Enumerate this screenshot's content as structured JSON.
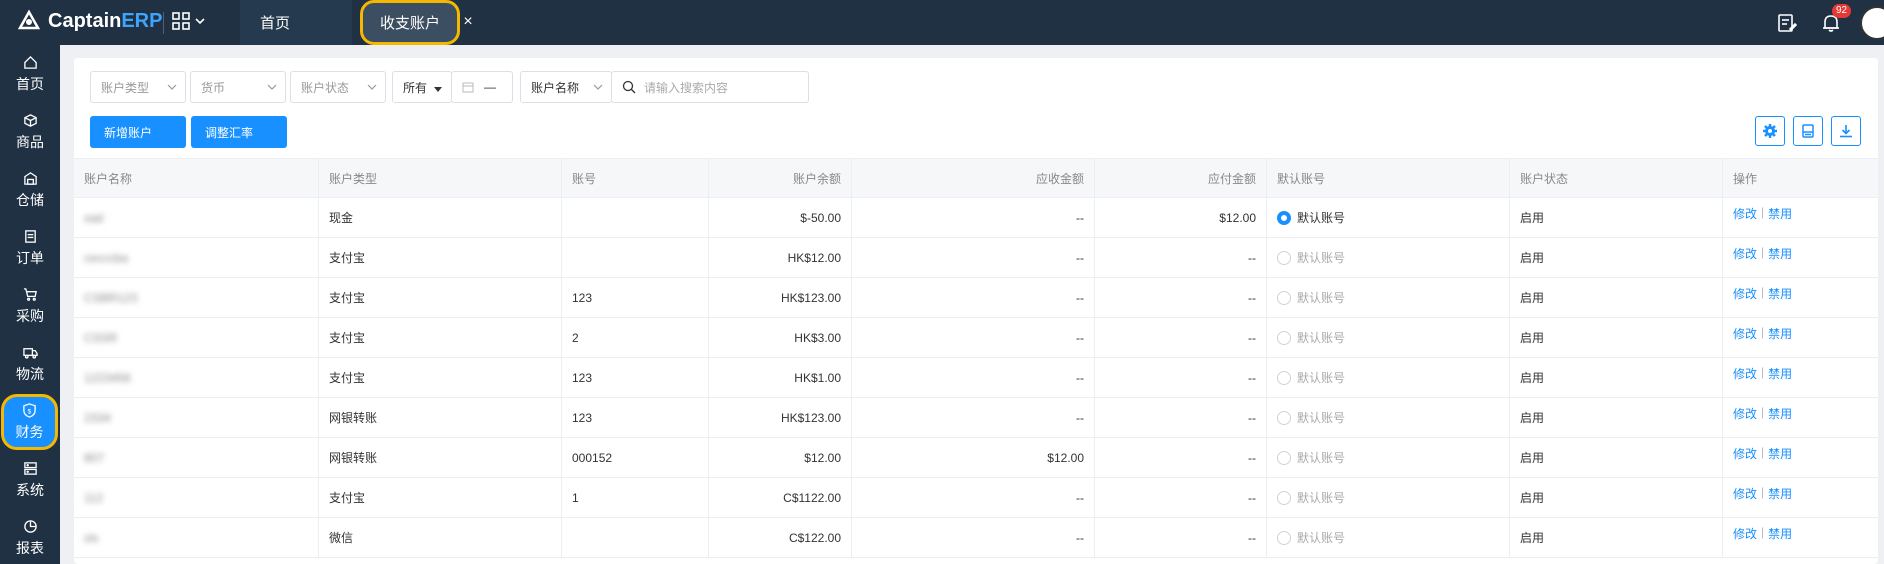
{
  "app": {
    "brand_main": "Captain",
    "brand_accent": "ERP"
  },
  "tabs": {
    "home": "首页",
    "active": "收支账户",
    "close": "×"
  },
  "notifications": {
    "count": "92"
  },
  "sidebar": [
    {
      "label": "首页",
      "icon": "home-icon"
    },
    {
      "label": "商品",
      "icon": "box-icon"
    },
    {
      "label": "仓储",
      "icon": "warehouse-icon"
    },
    {
      "label": "订单",
      "icon": "order-icon"
    },
    {
      "label": "采购",
      "icon": "cart-icon"
    },
    {
      "label": "物流",
      "icon": "truck-icon"
    },
    {
      "label": "财务",
      "icon": "finance-icon",
      "active": true
    },
    {
      "label": "系统",
      "icon": "system-icon"
    },
    {
      "label": "报表",
      "icon": "chart-icon"
    }
  ],
  "filters": {
    "account_type": "账户类型",
    "currency": "货币",
    "account_status": "账户状态",
    "scope": "所有",
    "date_dash": "—",
    "account_name": "账户名称",
    "search_placeholder": "请输入搜索内容"
  },
  "actions": {
    "add_account": "新增账户",
    "adjust_rate": "调整汇率"
  },
  "table": {
    "headers": [
      "账户名称",
      "账户类型",
      "账号",
      "账户余额",
      "应收金额",
      "应付金额",
      "默认账号",
      "账户状态",
      "操作"
    ],
    "rows": [
      {
        "name": "sad",
        "type": "现金",
        "number": "",
        "balance": "$-50.00",
        "receivable": "--",
        "payable": "$12.00",
        "default": "默认账号",
        "default_on": true,
        "status": "启用",
        "edit": "修改",
        "disable": "禁用"
      },
      {
        "name": "cecccba",
        "type": "支付宝",
        "number": "",
        "balance": "HK$12.00",
        "receivable": "--",
        "payable": "--",
        "default": "默认账号",
        "default_on": false,
        "status": "启用",
        "edit": "修改",
        "disable": "禁用"
      },
      {
        "name": "CSBR123",
        "type": "支付宝",
        "number": "123",
        "balance": "HK$123.00",
        "receivable": "--",
        "payable": "--",
        "default": "默认账号",
        "default_on": false,
        "status": "启用",
        "edit": "修改",
        "disable": "禁用"
      },
      {
        "name": "CSSR",
        "type": "支付宝",
        "number": "2",
        "balance": "HK$3.00",
        "receivable": "--",
        "payable": "--",
        "default": "默认账号",
        "default_on": false,
        "status": "启用",
        "edit": "修改",
        "disable": "禁用"
      },
      {
        "name": "1223456",
        "type": "支付宝",
        "number": "123",
        "balance": "HK$1.00",
        "receivable": "--",
        "payable": "--",
        "default": "默认账号",
        "default_on": false,
        "status": "启用",
        "edit": "修改",
        "disable": "禁用"
      },
      {
        "name": "2334",
        "type": "网银转账",
        "number": "123",
        "balance": "HK$123.00",
        "receivable": "--",
        "payable": "--",
        "default": "默认账号",
        "default_on": false,
        "status": "启用",
        "edit": "修改",
        "disable": "禁用"
      },
      {
        "name": "807",
        "type": "网银转账",
        "number": "000152",
        "balance": "$12.00",
        "receivable": "$12.00",
        "payable": "--",
        "default": "默认账号",
        "default_on": false,
        "status": "启用",
        "edit": "修改",
        "disable": "禁用"
      },
      {
        "name": "112",
        "type": "支付宝",
        "number": "1",
        "balance": "C$1122.00",
        "receivable": "--",
        "payable": "--",
        "default": "默认账号",
        "default_on": false,
        "status": "启用",
        "edit": "修改",
        "disable": "禁用"
      },
      {
        "name": "xlx",
        "type": "微信",
        "number": "",
        "balance": "C$122.00",
        "receivable": "--",
        "payable": "--",
        "default": "默认账号",
        "default_on": false,
        "status": "启用",
        "edit": "修改",
        "disable": "禁用"
      }
    ]
  },
  "colors": {
    "topbar": "#1f3143",
    "primary": "#1890ff",
    "highlight": "#f5b800"
  }
}
